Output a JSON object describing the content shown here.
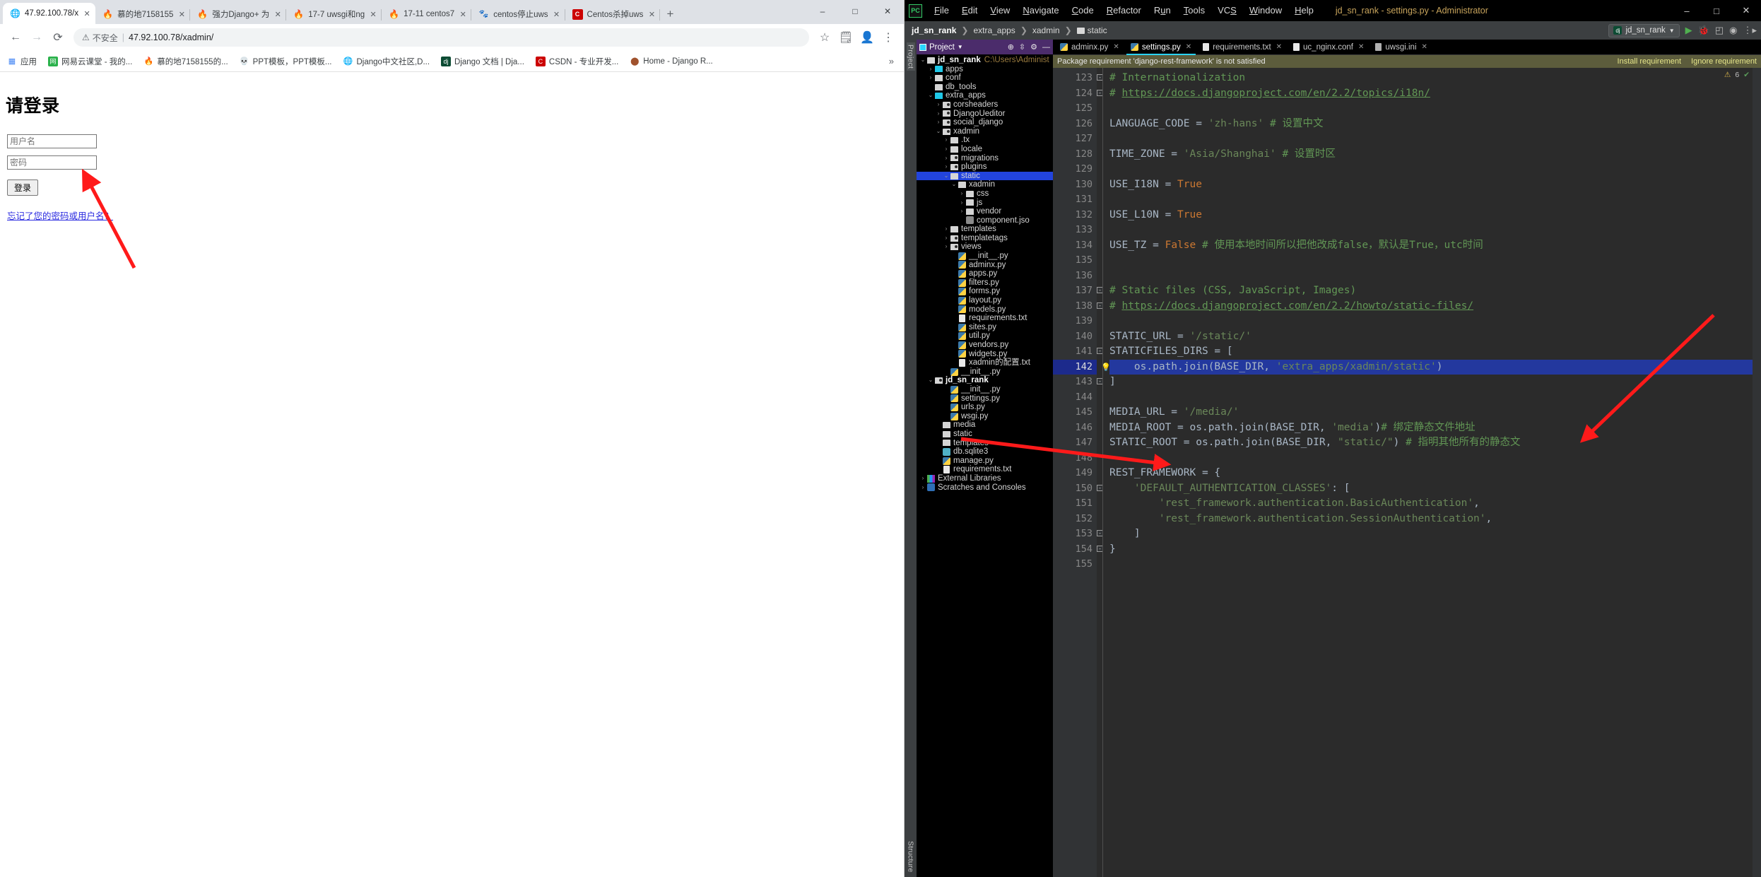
{
  "browser": {
    "tabs": [
      {
        "title": "47.92.100.78/x",
        "favicon": "globe-icon",
        "active": true
      },
      {
        "title": "慕的地7158155",
        "favicon": "flame-icon",
        "active": false
      },
      {
        "title": "强力Django+ 为",
        "favicon": "flame-icon",
        "active": false
      },
      {
        "title": "17-7 uwsgi和ng",
        "favicon": "flame-icon",
        "active": false
      },
      {
        "title": "17-11 centos7",
        "favicon": "flame-icon",
        "active": false
      },
      {
        "title": "centos停止uws",
        "favicon": "baidu-icon",
        "active": false
      },
      {
        "title": "Centos杀掉uws",
        "favicon": "csdn-icon",
        "active": false
      }
    ],
    "new_tab_label": "+",
    "window_controls": {
      "minimize": "–",
      "maximize": "□",
      "close": "✕"
    },
    "toolbar": {
      "back": "←",
      "forward": "→",
      "reload": "C",
      "security_warning": "不安全",
      "url": "47.92.100.78/xadmin/",
      "bookmark_star": "☆",
      "reading_list": "≡",
      "profile": "person-icon",
      "menu": "⋮"
    },
    "bookmarks": [
      {
        "label": "应用",
        "icon": "apps-grid-icon"
      },
      {
        "label": "网易云课堂 - 我的...",
        "icon": "netease-icon"
      },
      {
        "label": "慕的地7158155的...",
        "icon": "flame-icon"
      },
      {
        "label": "PPT模板，PPT模板...",
        "icon": "skull-icon"
      },
      {
        "label": "Django中文社区,D...",
        "icon": "globe-icon"
      },
      {
        "label": "Django 文档 | Dja...",
        "icon": "dj-icon"
      },
      {
        "label": "CSDN - 专业开发...",
        "icon": "csdn-icon"
      },
      {
        "label": "Home - Django R...",
        "icon": "circle-icon"
      }
    ],
    "bookmarks_overflow": "»",
    "page": {
      "heading": "请登录",
      "username_placeholder": "用户名",
      "username_value": "",
      "password_placeholder": "密码",
      "password_value": "",
      "submit_label": "登录",
      "forgot_link": "忘记了您的密码或用户名？"
    }
  },
  "ide": {
    "app_icon": "PC",
    "menu": [
      {
        "label": "File",
        "mnemonic": "F"
      },
      {
        "label": "Edit",
        "mnemonic": "E"
      },
      {
        "label": "View",
        "mnemonic": "V"
      },
      {
        "label": "Navigate",
        "mnemonic": "N"
      },
      {
        "label": "Code",
        "mnemonic": "C"
      },
      {
        "label": "Refactor",
        "mnemonic": "R"
      },
      {
        "label": "Run",
        "mnemonic": "u"
      },
      {
        "label": "Tools",
        "mnemonic": "T"
      },
      {
        "label": "VCS",
        "mnemonic": "S"
      },
      {
        "label": "Window",
        "mnemonic": "W"
      },
      {
        "label": "Help",
        "mnemonic": "H"
      }
    ],
    "window_title": "jd_sn_rank - settings.py - Administrator",
    "window_controls": {
      "minimize": "–",
      "maximize": "□",
      "close": "✕"
    },
    "breadcrumbs": [
      "jd_sn_rank",
      "extra_apps",
      "xadmin",
      "static"
    ],
    "run_config": "jd_sn_rank",
    "toolbar_icons": [
      "run-icon",
      "debug-icon",
      "coverage-icon",
      "profile-icon",
      "more-icon"
    ],
    "project_pane": {
      "title": "Project",
      "icons": [
        "locate-icon",
        "collapse-all-icon",
        "settings-gear-icon",
        "hide-icon"
      ],
      "tree": [
        {
          "depth": 0,
          "chev": "v",
          "icon": "folder-module",
          "label": "jd_sn_rank",
          "bold": true,
          "path": "C:\\Users\\Administ",
          "sel": false
        },
        {
          "depth": 1,
          "chev": ">",
          "icon": "folder-source",
          "label": "apps",
          "sel": false
        },
        {
          "depth": 1,
          "chev": ">",
          "icon": "folder",
          "label": "conf",
          "sel": false
        },
        {
          "depth": 1,
          "chev": "",
          "icon": "folder",
          "label": "db_tools",
          "sel": false
        },
        {
          "depth": 1,
          "chev": "v",
          "icon": "folder-source",
          "label": "extra_apps",
          "sel": false
        },
        {
          "depth": 2,
          "chev": ">",
          "icon": "folder-pkg",
          "label": "corsheaders",
          "sel": false
        },
        {
          "depth": 2,
          "chev": ">",
          "icon": "folder-pkg",
          "label": "DjangoUeditor",
          "sel": false
        },
        {
          "depth": 2,
          "chev": ">",
          "icon": "folder-pkg",
          "label": "social_django",
          "sel": false
        },
        {
          "depth": 2,
          "chev": "v",
          "icon": "folder-pkg",
          "label": "xadmin",
          "sel": false
        },
        {
          "depth": 3,
          "chev": ">",
          "icon": "folder",
          "label": ".tx",
          "sel": false
        },
        {
          "depth": 3,
          "chev": ">",
          "icon": "folder",
          "label": "locale",
          "sel": false
        },
        {
          "depth": 3,
          "chev": ">",
          "icon": "folder-pkg",
          "label": "migrations",
          "sel": false
        },
        {
          "depth": 3,
          "chev": ">",
          "icon": "folder-pkg",
          "label": "plugins",
          "sel": false
        },
        {
          "depth": 3,
          "chev": "v",
          "icon": "folder",
          "label": "static",
          "sel": true
        },
        {
          "depth": 4,
          "chev": "v",
          "icon": "folder",
          "label": "xadmin",
          "sel": false
        },
        {
          "depth": 5,
          "chev": ">",
          "icon": "folder",
          "label": "css",
          "sel": false
        },
        {
          "depth": 5,
          "chev": ">",
          "icon": "folder",
          "label": "js",
          "sel": false
        },
        {
          "depth": 5,
          "chev": ">",
          "icon": "folder",
          "label": "vendor",
          "sel": false
        },
        {
          "depth": 5,
          "chev": "",
          "icon": "json",
          "label": "component.jso",
          "sel": false
        },
        {
          "depth": 3,
          "chev": ">",
          "icon": "folder",
          "label": "templates",
          "sel": false
        },
        {
          "depth": 3,
          "chev": ">",
          "icon": "folder-pkg",
          "label": "templatetags",
          "sel": false
        },
        {
          "depth": 3,
          "chev": ">",
          "icon": "folder-pkg",
          "label": "views",
          "sel": false
        },
        {
          "depth": 4,
          "chev": "",
          "icon": "py",
          "label": "__init__.py",
          "sel": false
        },
        {
          "depth": 4,
          "chev": "",
          "icon": "py",
          "label": "adminx.py",
          "sel": false
        },
        {
          "depth": 4,
          "chev": "",
          "icon": "py",
          "label": "apps.py",
          "sel": false
        },
        {
          "depth": 4,
          "chev": "",
          "icon": "py",
          "label": "filters.py",
          "sel": false
        },
        {
          "depth": 4,
          "chev": "",
          "icon": "py",
          "label": "forms.py",
          "sel": false
        },
        {
          "depth": 4,
          "chev": "",
          "icon": "py",
          "label": "layout.py",
          "sel": false
        },
        {
          "depth": 4,
          "chev": "",
          "icon": "py",
          "label": "models.py",
          "sel": false
        },
        {
          "depth": 4,
          "chev": "",
          "icon": "txt",
          "label": "requirements.txt",
          "sel": false
        },
        {
          "depth": 4,
          "chev": "",
          "icon": "py",
          "label": "sites.py",
          "sel": false
        },
        {
          "depth": 4,
          "chev": "",
          "icon": "py",
          "label": "util.py",
          "sel": false
        },
        {
          "depth": 4,
          "chev": "",
          "icon": "py",
          "label": "vendors.py",
          "sel": false
        },
        {
          "depth": 4,
          "chev": "",
          "icon": "py",
          "label": "widgets.py",
          "sel": false
        },
        {
          "depth": 4,
          "chev": "",
          "icon": "txt",
          "label": "xadmin的配置.txt",
          "sel": false
        },
        {
          "depth": 3,
          "chev": "",
          "icon": "py",
          "label": "__init__.py",
          "sel": false
        },
        {
          "depth": 1,
          "chev": "v",
          "icon": "folder-pkg",
          "label": "jd_sn_rank",
          "bold": true,
          "sel": false
        },
        {
          "depth": 3,
          "chev": "",
          "icon": "py",
          "label": "__init__.py",
          "sel": false
        },
        {
          "depth": 3,
          "chev": "",
          "icon": "py",
          "label": "settings.py",
          "sel": false
        },
        {
          "depth": 3,
          "chev": "",
          "icon": "py",
          "label": "urls.py",
          "sel": false
        },
        {
          "depth": 3,
          "chev": "",
          "icon": "py",
          "label": "wsgi.py",
          "sel": false
        },
        {
          "depth": 2,
          "chev": "",
          "icon": "folder",
          "label": "media",
          "sel": false
        },
        {
          "depth": 2,
          "chev": "",
          "icon": "folder",
          "label": "static",
          "sel": false
        },
        {
          "depth": 2,
          "chev": "",
          "icon": "folder",
          "label": "templates",
          "sel": false
        },
        {
          "depth": 2,
          "chev": "",
          "icon": "db",
          "label": "db.sqlite3",
          "sel": false
        },
        {
          "depth": 2,
          "chev": "",
          "icon": "py",
          "label": "manage.py",
          "sel": false
        },
        {
          "depth": 2,
          "chev": "",
          "icon": "txt",
          "label": "requirements.txt",
          "sel": false
        },
        {
          "depth": 0,
          "chev": ">",
          "icon": "lib",
          "label": "External Libraries",
          "sel": false
        },
        {
          "depth": 0,
          "chev": ">",
          "icon": "scratch",
          "label": "Scratches and Consoles",
          "sel": false
        }
      ]
    },
    "editor_tabs": [
      {
        "label": "adminx.py",
        "icon": "py-icon",
        "active": false
      },
      {
        "label": "settings.py",
        "icon": "py-icon",
        "active": true
      },
      {
        "label": "requirements.txt",
        "icon": "txt-icon",
        "active": false
      },
      {
        "label": "uc_nginx.conf",
        "icon": "conf-icon",
        "active": false
      },
      {
        "label": "uwsgi.ini",
        "icon": "ini-icon",
        "active": false
      }
    ],
    "inspection": {
      "message": "Package requirement 'django-rest-framework' is not satisfied",
      "action_install": "Install requirement",
      "action_ignore": "Ignore requirement"
    },
    "error_badge": {
      "warnings": "6",
      "ok": "✔"
    },
    "current_line": 142,
    "code": [
      {
        "n": 123,
        "fold": "-",
        "html": "<span class='k-com'># Internationalization</span>"
      },
      {
        "n": 124,
        "fold": "-",
        "html": "<span class='k-com'># </span><span class='k-comlink'>https://docs.djangoproject.com/en/2.2/topics/i18n/</span>"
      },
      {
        "n": 125,
        "fold": "",
        "html": ""
      },
      {
        "n": 126,
        "fold": "",
        "html": "<span class='k-id'>LANGUAGE_CODE</span> = <span class='k-str'>'zh-hans'</span><span class='k-com'> # 设置中文</span>"
      },
      {
        "n": 127,
        "fold": "",
        "html": ""
      },
      {
        "n": 128,
        "fold": "",
        "html": "<span class='k-id'>TIME_ZONE</span> = <span class='k-str'>'Asia/Shanghai'</span><span class='k-com'> # 设置时区</span>"
      },
      {
        "n": 129,
        "fold": "",
        "html": ""
      },
      {
        "n": 130,
        "fold": "",
        "html": "<span class='k-id'>USE_I18N</span> = <span class='k-kw'>True</span>"
      },
      {
        "n": 131,
        "fold": "",
        "html": ""
      },
      {
        "n": 132,
        "fold": "",
        "html": "<span class='k-id'>USE_L10N</span> = <span class='k-kw'>True</span>"
      },
      {
        "n": 133,
        "fold": "",
        "html": ""
      },
      {
        "n": 134,
        "fold": "",
        "html": "<span class='k-id'>USE_TZ</span> = <span class='k-kw'>False</span><span class='k-com'> # 使用本地时间所以把他改成false，默认是True，utc时间</span>"
      },
      {
        "n": 135,
        "fold": "",
        "html": ""
      },
      {
        "n": 136,
        "fold": "",
        "html": ""
      },
      {
        "n": 137,
        "fold": "-",
        "html": "<span class='k-com'># Static files (CSS, JavaScript, Images)</span>"
      },
      {
        "n": 138,
        "fold": "-",
        "html": "<span class='k-com'># </span><span class='k-comlink'>https://docs.djangoproject.com/en/2.2/howto/static-files/</span>"
      },
      {
        "n": 139,
        "fold": "",
        "html": ""
      },
      {
        "n": 140,
        "fold": "",
        "html": "<span class='k-id'>STATIC_URL</span> = <span class='k-str'>'/static/'</span>"
      },
      {
        "n": 141,
        "fold": "-",
        "html": "<span class='k-id'>STATICFILES_DIRS</span> = ["
      },
      {
        "n": 142,
        "fold": "",
        "cur": true,
        "bulb": true,
        "html": "    <span class='k-id'>os.path.join</span>(<span class='k-id'>BASE_DIR</span>, <span class='k-str'>'extra_apps/xadmin/static'</span>)"
      },
      {
        "n": 143,
        "fold": "-",
        "html": "]"
      },
      {
        "n": 144,
        "fold": "",
        "html": ""
      },
      {
        "n": 145,
        "fold": "",
        "html": "<span class='k-id'>MEDIA_URL</span> = <span class='k-str'>'/media/'</span>"
      },
      {
        "n": 146,
        "fold": "",
        "html": "<span class='k-id'>MEDIA_ROOT</span> = <span class='k-id'>os.path.join</span>(<span class='k-id'>BASE_DIR</span>, <span class='k-str'>'media'</span>)<span class='k-com'># 绑定静态文件地址</span>"
      },
      {
        "n": 147,
        "fold": "",
        "html": "<span class='k-id'>STATIC_ROOT</span> = <span class='k-id'>os.path.join</span>(<span class='k-id'>BASE_DIR</span>, <span class='k-str'>\"static/\"</span>)<span class='k-com'> # 指明其他所有的静态文</span>"
      },
      {
        "n": 148,
        "fold": "",
        "html": ""
      },
      {
        "n": 149,
        "fold": "",
        "html": "<span class='k-id'>REST_FRAMEWORK</span> = {"
      },
      {
        "n": 150,
        "fold": "-",
        "html": "    <span class='k-str'>'DEFAULT_AUTHENTICATION_CLASSES'</span>: ["
      },
      {
        "n": 151,
        "fold": "",
        "html": "        <span class='k-str'>'rest_framework.authentication.BasicAuthentication'</span>,"
      },
      {
        "n": 152,
        "fold": "",
        "html": "        <span class='k-str'>'rest_framework.authentication.SessionAuthentication'</span>,"
      },
      {
        "n": 153,
        "fold": "-",
        "html": "    ]"
      },
      {
        "n": 154,
        "fold": "-",
        "html": "}"
      },
      {
        "n": 155,
        "fold": "",
        "html": ""
      }
    ],
    "left_tool_tabs": [
      "Project",
      "Structure"
    ]
  }
}
